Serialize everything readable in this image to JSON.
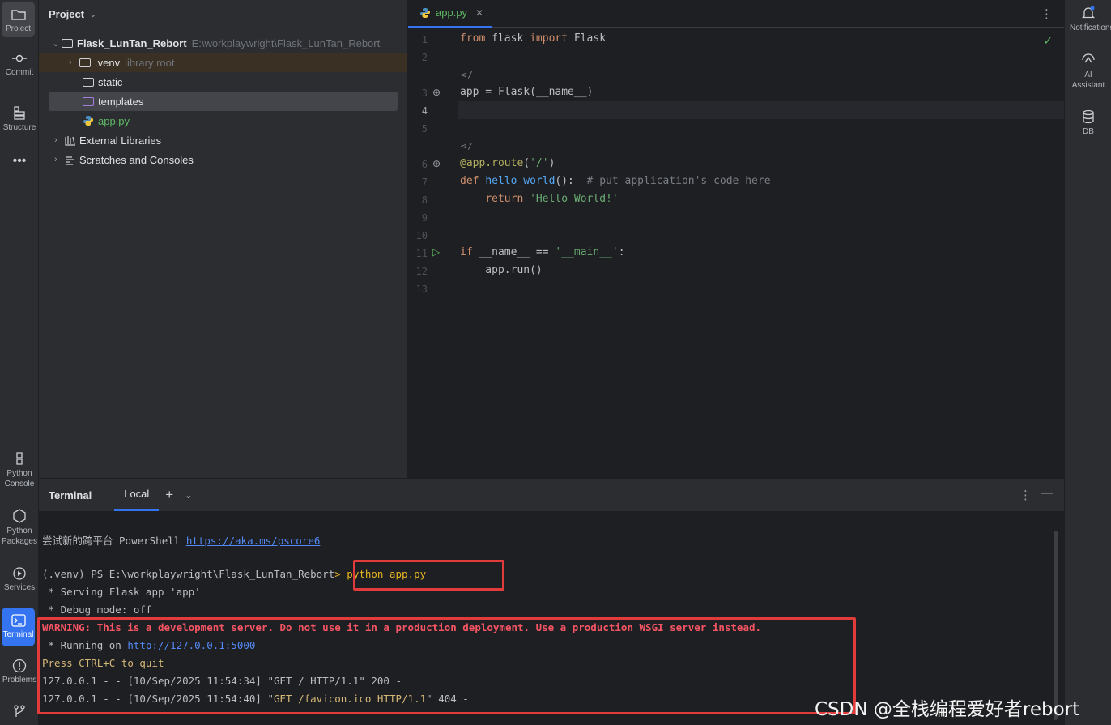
{
  "left_tools": [
    {
      "label": "Project",
      "icon": "folder-icon"
    },
    {
      "label": "Commit",
      "icon": "commit-icon"
    },
    {
      "label": "Structure",
      "icon": "structure-icon"
    },
    {
      "label": "Python Console",
      "icon": "python-console-icon"
    },
    {
      "label": "Python Packages",
      "icon": "python-packages-icon"
    },
    {
      "label": "Services",
      "icon": "services-icon"
    },
    {
      "label": "Terminal",
      "icon": "terminal-icon"
    },
    {
      "label": "Problems",
      "icon": "problems-icon"
    }
  ],
  "right_tools": [
    {
      "label": "Notifications",
      "icon": "bell-icon"
    },
    {
      "label": "AI Assistant",
      "icon": "ai-assistant-icon"
    },
    {
      "label": "DB",
      "icon": "database-icon"
    }
  ],
  "project": {
    "title": "Project",
    "root_name": "Flask_LunTan_Rebort",
    "root_path": "E:\\workplaywright\\Flask_LunTan_Rebort",
    "venv_name": ".venv",
    "venv_hint": "library root",
    "static": "static",
    "templates": "templates",
    "app_file": "app.py",
    "external_libraries": "External Libraries",
    "scratches": "Scratches and Consoles"
  },
  "editor": {
    "tab_name": "app.py",
    "line_numbers": [
      "1",
      "2",
      "3",
      "4",
      "5",
      "6",
      "7",
      "8",
      "9",
      "10",
      "11",
      "12",
      "13"
    ],
    "usage_hint": "/"
  },
  "terminal": {
    "title": "Terminal",
    "tab_label": "Local",
    "line_ps_hint_prefix": "尝试新的跨平台 PowerShell ",
    "line_ps_hint_link": "https://aka.ms/pscore6",
    "prompt": "(.venv) PS E:\\workplaywright\\Flask_LunTan_Rebort",
    "prompt_sep": "> ",
    "command": "python app.py",
    "serving": " * Serving Flask app 'app'",
    "debug": " * Debug mode: off",
    "warning": "WARNING: This is a development server. Do not use it in a production deployment. Use a production WSGI server instead.",
    "running_prefix": " * Running on ",
    "running_link": "http://127.0.0.1:5000",
    "quit": "Press CTRL+C to quit",
    "log1_prefix": "127.0.0.1 - - [10/Sep/2025 11:54:34] \"GET / HTTP/1.1\" 200 -",
    "log2_prefix": "127.0.0.1 - - [10/Sep/2025 11:54:40] \"",
    "log2_req": "GET /favicon.ico HTTP/1.1",
    "log2_suffix": "\" 404 -"
  },
  "watermark": "CSDN @全栈编程爱好者rebort",
  "colors": {
    "accent": "#3574f0",
    "highlight_box": "#e23b3b",
    "success": "#5fb865"
  }
}
